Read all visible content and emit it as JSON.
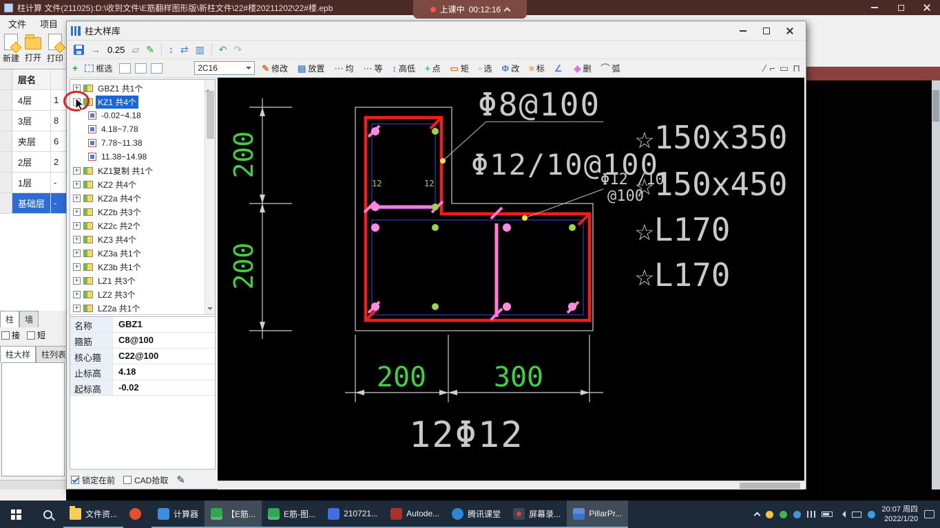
{
  "titlebar": {
    "title": "柱计算 文件(211025):D:\\收到文件\\E筋翻样图形版\\新柱文件\\22#楼20211202\\22#楼.epb",
    "notification": {
      "label": "上课中",
      "time": "00:12:16"
    }
  },
  "menu": {
    "items": [
      "文件",
      "项目"
    ]
  },
  "main_toolbar": {
    "buttons": [
      "新建",
      "打开",
      "打印"
    ]
  },
  "floors": {
    "header": "层名",
    "rows": [
      {
        "name": "4层",
        "value": "1"
      },
      {
        "name": "3层",
        "value": "8"
      },
      {
        "name": "夹层",
        "value": "6"
      },
      {
        "name": "2层",
        "value": "2"
      },
      {
        "name": "1层",
        "value": "-"
      },
      {
        "name": "基础层",
        "value": "-"
      }
    ]
  },
  "left_panel": {
    "tabs": [
      "柱",
      "墙"
    ],
    "checks": [
      "接",
      "短"
    ],
    "subtabs": [
      "柱大样",
      "柱列表"
    ]
  },
  "dialog": {
    "title": "柱大样库",
    "toolbar1": {
      "scale": "0.25",
      "glyphs": {
        "export": "→",
        "measure": "▱",
        "brush": "✎",
        "sort1": "↕",
        "sort2": "⇄",
        "grid": "▥",
        "undo": "↶",
        "redo": "↷"
      }
    },
    "toolbar2": {
      "plus": "+",
      "box_select": "框选",
      "combo": "2C16",
      "tools": [
        {
          "glyph": "✎",
          "label": "修改"
        },
        {
          "glyph": "▤",
          "label": "放置"
        },
        {
          "glyph": "⋯",
          "label": "均"
        },
        {
          "glyph": "⋯",
          "label": "等"
        },
        {
          "glyph": "↕",
          "label": "高低"
        },
        {
          "glyph": "+",
          "label": "点"
        },
        {
          "glyph": "▭",
          "label": "矩"
        },
        {
          "glyph": "▫",
          "label": "选"
        },
        {
          "glyph": "Φ",
          "label": "改"
        },
        {
          "glyph": "≡",
          "label": "标"
        },
        {
          "glyph": "∠",
          "label": ""
        },
        {
          "glyph": "◈",
          "label": "删"
        },
        {
          "glyph": "⌒",
          "label": "弧"
        }
      ],
      "draw_tools": [
        "∕",
        "⌐",
        "▭",
        "⊓"
      ]
    },
    "tree": [
      {
        "expand": "+",
        "label": "GBZ1 共1个"
      },
      {
        "expand": "-",
        "label": "KZ1 共4个"
      },
      {
        "label": "-0.02~4.18"
      },
      {
        "label": "4.18~7.78"
      },
      {
        "label": "7.78~11.38"
      },
      {
        "label": "11.38~14.98"
      },
      {
        "expand": "+",
        "label": "KZ1复制 共1个"
      },
      {
        "expand": "+",
        "label": "KZ2 共4个"
      },
      {
        "expand": "+",
        "label": "KZ2a 共4个"
      },
      {
        "expand": "+",
        "label": "KZ2b 共3个"
      },
      {
        "expand": "+",
        "label": "KZ2c 共2个"
      },
      {
        "expand": "+",
        "label": "KZ3 共4个"
      },
      {
        "expand": "+",
        "label": "KZ3a 共1个"
      },
      {
        "expand": "+",
        "label": "KZ3b 共1个"
      },
      {
        "expand": "+",
        "label": "LZ1 共3个"
      },
      {
        "expand": "+",
        "label": "LZ2 共3个"
      },
      {
        "expand": "+",
        "label": "LZ2a 共1个"
      }
    ],
    "properties": [
      {
        "label": "名称",
        "value": "GBZ1"
      },
      {
        "label": "箍筋",
        "value": "C8@100"
      },
      {
        "label": "核心箍",
        "value": "C22@100"
      },
      {
        "label": "止标高",
        "value": "4.18"
      },
      {
        "label": "起标高",
        "value": "-0.02"
      }
    ],
    "footer": {
      "lock_label": "锁定在前",
      "cad_label": "CAD拾取",
      "pencil": "✎"
    }
  },
  "cad": {
    "dim_left": [
      "200",
      "200"
    ],
    "dim_bottom": [
      "200",
      "300"
    ],
    "label_top": "Φ8@100",
    "label_mid": "Φ12/10@100",
    "label_callout_1": "Φ12 /10",
    "label_callout_2": "@100",
    "right_labels": [
      "☆150x350",
      "☆150x450",
      "☆L170",
      "☆L170"
    ],
    "label_bottom": "12Φ12",
    "bar_marks": [
      "12",
      "12"
    ]
  },
  "taskbar": {
    "items": [
      {
        "label": "文件资..."
      },
      {
        "label": ""
      },
      {
        "label": "计算器"
      },
      {
        "label": "【E筋..."
      },
      {
        "label": "E筋-图..."
      },
      {
        "label": "210721..."
      },
      {
        "label": "Autode..."
      },
      {
        "label": "腾讯课堂"
      },
      {
        "label": "屏幕录..."
      },
      {
        "label": "PillarPr..."
      }
    ],
    "clock": {
      "line1": "20:07 周四",
      "line2": "2022/1/20"
    }
  }
}
